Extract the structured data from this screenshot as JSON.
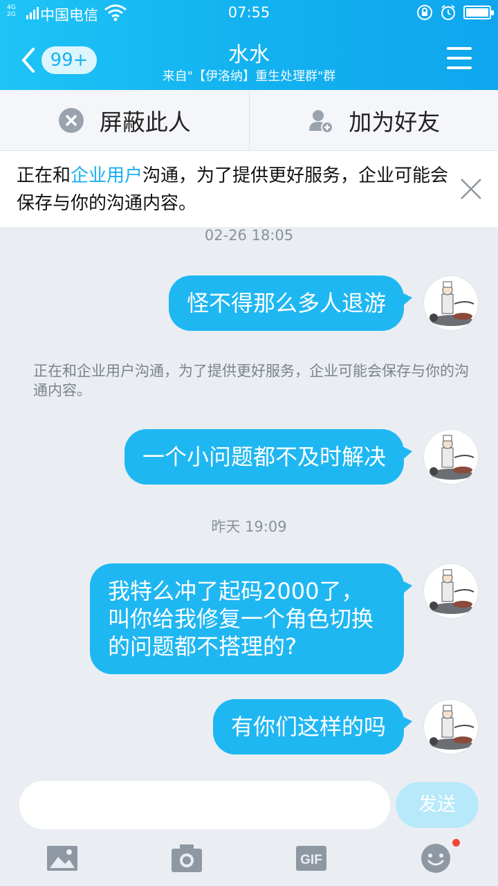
{
  "status_bar": {
    "network": "4G\n2G",
    "carrier": "中国电信",
    "time": "07:55"
  },
  "header": {
    "unread_badge": "99+",
    "title": "水水",
    "subtitle": "来自\"【伊洛纳】重生处理群\"群"
  },
  "actions": {
    "block_label": "屏蔽此人",
    "add_friend_label": "加为好友"
  },
  "banner": {
    "prefix": "正在和",
    "link": "企业用户",
    "suffix": "沟通，为了提供更好服务，企业可能会保存与你的沟通内容。"
  },
  "messages": {
    "timestamp_1": "02-26 18:05",
    "msg_1": "怪不得那么多人退游",
    "system_notice": "正在和企业用户沟通，为了提供更好服务，企业可能会保存与你的沟通内容。",
    "msg_2": "一个小问题都不及时解决",
    "timestamp_2": "昨天 19:09",
    "msg_3_line1": "我特么冲了起码2000了，",
    "msg_3_line2": "叫你给我修复一个角色切换",
    "msg_3_line3": "的问题都不搭理的?",
    "msg_4": "有你们这样的吗"
  },
  "input": {
    "placeholder": "",
    "send_label": "发送"
  },
  "colors": {
    "accent": "#1fb7f2",
    "header_gradient_start": "#1ec4f6",
    "header_gradient_end": "#0fa6ee",
    "notification_dot": "#f5443c"
  }
}
